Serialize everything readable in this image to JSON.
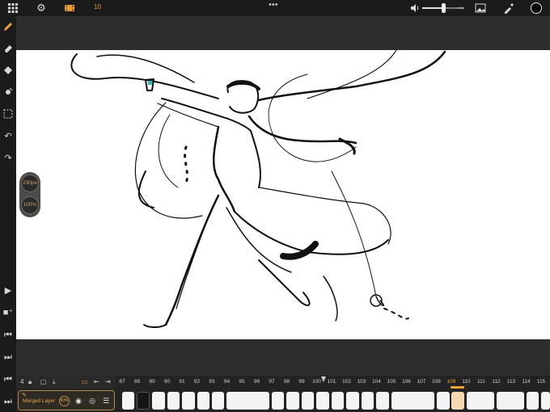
{
  "topbar": {
    "frame_count": "10",
    "more_menu": "•••",
    "volume_level": 0.5
  },
  "brush": {
    "size": "230px",
    "opacity": "100%"
  },
  "timeline": {
    "left_counter": "4",
    "ruler_labels": [
      "87",
      "88",
      "89",
      "90",
      "91",
      "92",
      "93",
      "94",
      "95",
      "96",
      "97",
      "98",
      "99",
      "100",
      "101",
      "102",
      "103",
      "104",
      "105",
      "106",
      "107",
      "108",
      "109",
      "110",
      "111",
      "112",
      "113",
      "114",
      "115"
    ],
    "current_frame": "109",
    "layer": {
      "name": "Merged Layer",
      "opacity": "60%"
    }
  },
  "colors": {
    "accent": "#f0a33a",
    "current_color": "#000000",
    "canvas": "#ffffff"
  }
}
